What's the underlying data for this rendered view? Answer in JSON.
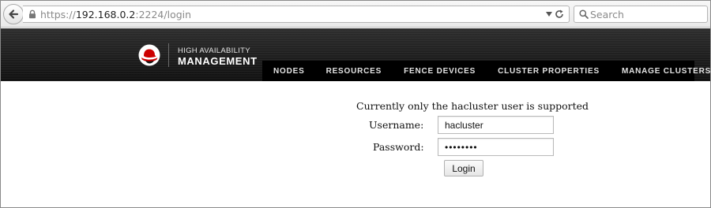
{
  "browser": {
    "url_prefix": "https://",
    "url_host": "192.168.0.2",
    "url_suffix": ":2224/login",
    "search_placeholder": "Search"
  },
  "brand": {
    "line1": "HIGH AVAILABILITY",
    "line2": "MANAGEMENT",
    "logo_icon": "red-hat-shadowman-icon",
    "logo_color": "#cc0000"
  },
  "nav": {
    "nodes": "NODES",
    "resources": "RESOURCES",
    "fence_devices": "FENCE DEVICES",
    "cluster_properties": "CLUSTER PROPERTIES",
    "manage_clusters": "MANAGE CLUSTERS"
  },
  "login": {
    "notice": "Currently only the hacluster user is supported",
    "username_label": "Username:",
    "username_value": "hacluster",
    "password_label": "Password:",
    "password_mask": "••••••••",
    "button_label": "Login"
  }
}
